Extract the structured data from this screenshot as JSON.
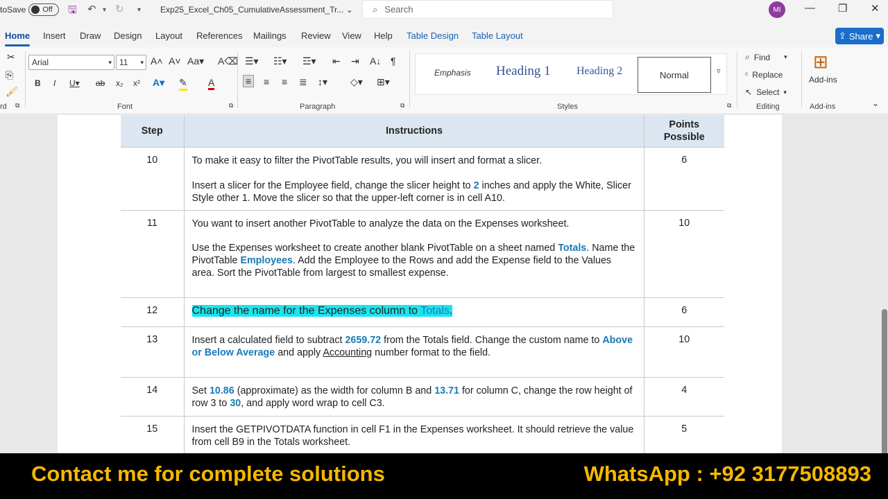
{
  "titlebar": {
    "autosave_label": "toSave",
    "toggle_label": "Off",
    "doc_title": "Exp25_Excel_Ch05_CumulativeAssessment_Tr...",
    "search_placeholder": "Search",
    "avatar_initials": "MI"
  },
  "menu": {
    "tabs": [
      "Home",
      "Insert",
      "Draw",
      "Design",
      "Layout",
      "References",
      "Mailings",
      "Review",
      "View",
      "Help",
      "Table Design",
      "Table Layout"
    ],
    "share_label": "Share"
  },
  "ribbon": {
    "font_name": "Arial",
    "font_size": "11",
    "group_font": "Font",
    "group_paragraph": "Paragraph",
    "group_styles": "Styles",
    "group_editing": "Editing",
    "group_addins": "Add-ins",
    "clipboard_partial": "rd",
    "styles": {
      "emphasis": "Emphasis",
      "heading1": "Heading 1",
      "heading2": "Heading 2",
      "normal": "Normal"
    },
    "editing": {
      "find": "Find",
      "replace": "Replace",
      "select": "Select"
    },
    "addins_label": "Add-ins"
  },
  "table": {
    "headers": {
      "step": "Step",
      "instructions": "Instructions",
      "points_line1": "Points",
      "points_line2": "Possible"
    },
    "rows": {
      "r10": {
        "step": "10",
        "p1": "To make it easy to filter the PivotTable results, you will insert and format a slicer.",
        "p2a": "Insert a slicer for the Employee field, change the slicer height to ",
        "p2b": "2",
        "p2c": " inches and apply the White, Slicer Style other 1. Move the slicer so that the upper-left corner is in cell A10.",
        "points": "6"
      },
      "r11": {
        "step": "11",
        "p1": "You want to insert another PivotTable to analyze the data on the Expenses worksheet.",
        "p2a": "Use the Expenses worksheet to create another blank PivotTable on a sheet named ",
        "p2b": "Totals",
        "p2c": ". Name the PivotTable ",
        "p2d": "Employees",
        "p2e": ". Add the Employee to the Rows and add the Expense field to the Values area. Sort the PivotTable from largest to smallest expense.",
        "points": "10"
      },
      "r12": {
        "step": "12",
        "p1a": "Change the name for the Expenses column to ",
        "p1b": "Totals",
        "p1c": ".",
        "points": "6"
      },
      "r13": {
        "step": "13",
        "p1a": "Insert a calculated field to subtract ",
        "p1b": "2659.72",
        "p1c": " from the Totals field. Change the custom name to ",
        "p1d": "Above or Below Average",
        "p1e": " and apply ",
        "p1f": "Accounting",
        "p1g": " number format to the field.",
        "points": "10"
      },
      "r14": {
        "step": "14",
        "p1a": "Set ",
        "p1b": "10.86",
        "p1c": " (approximate) as the width for column B and ",
        "p1d": "13.71",
        "p1e": " for column C, change the row height of row 3 to ",
        "p1f": "30",
        "p1g": ", and apply word wrap to cell C3.",
        "points": "4"
      },
      "r15": {
        "step": "15",
        "p1": "Insert the GETPIVOTDATA function in cell F1 in the Expenses worksheet. It should retrieve the value from cell B9 in the Totals worksheet.",
        "points": "5"
      }
    }
  },
  "banner": {
    "left": "Contact me for complete solutions",
    "right": "WhatsApp : +92 3177508893"
  },
  "colors": {
    "accent": "#1a5fb4",
    "highlight": "#19e5f0",
    "banner_text": "#f5b800",
    "table_header_bg": "#dbe6f1"
  }
}
